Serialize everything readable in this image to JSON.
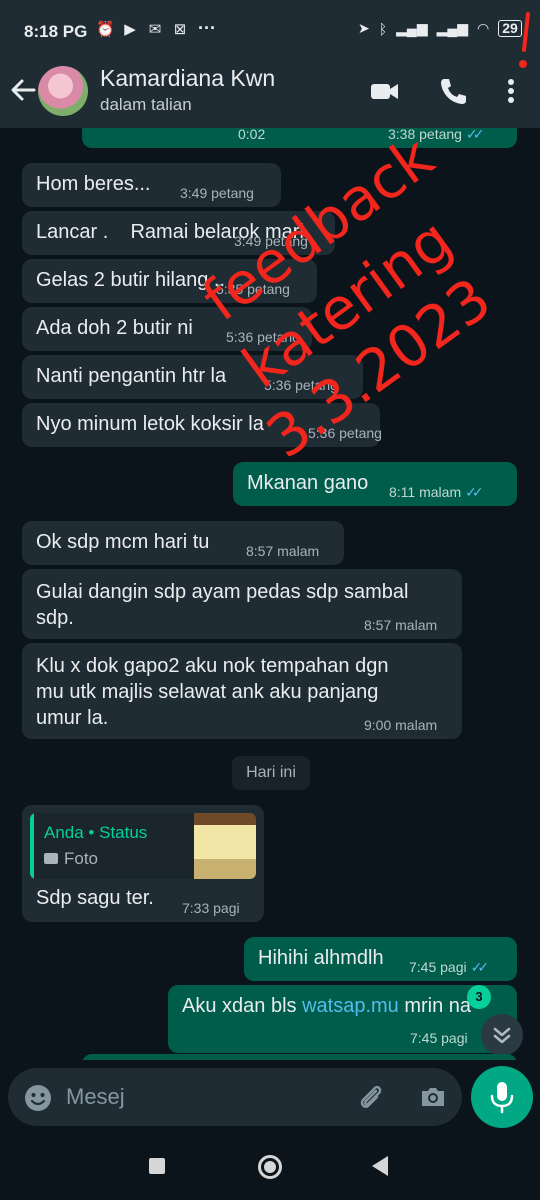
{
  "status_bar": {
    "time": "8:18 PG",
    "notification_icons": [
      "alarm-icon",
      "youtube-icon",
      "mail-icon",
      "app-icon"
    ],
    "more": "···",
    "battery": "29",
    "right_icons": [
      "location-icon",
      "bluetooth-icon",
      "signal-icon",
      "signal-icon",
      "wifi-icon",
      "battery-icon"
    ]
  },
  "header": {
    "contact_name": "Kamardiana Kwn",
    "status": "dalam talian",
    "icons": [
      "back-arrow-icon",
      "avatar",
      "video-call-icon",
      "phone-icon",
      "more-vertical-icon"
    ]
  },
  "chat": {
    "top_partial": {
      "duration": "0:02",
      "time": "3:38 petang"
    },
    "messages": [
      {
        "dir": "in",
        "text": "Hom beres...",
        "time": "3:49 petang"
      },
      {
        "dir": "in",
        "text": "Lancar .    Ramai belarok mari.",
        "time": "3:49 petang"
      },
      {
        "dir": "in",
        "text": "Gelas 2 butir hilang ..",
        "time": "5:35 petang"
      },
      {
        "dir": "in",
        "text": "Ada doh 2 butir ni",
        "time": "5:36 petang"
      },
      {
        "dir": "in",
        "text": "Nanti pengantin htr la",
        "time": "5:36 petang"
      },
      {
        "dir": "in",
        "text": "Nyo minum letok koksir la",
        "time": "5:36 petang"
      },
      {
        "dir": "out",
        "text": "Mkanan gano",
        "time": "8:11 malam"
      },
      {
        "dir": "in",
        "text": "Ok sdp mcm hari tu",
        "time": "8:57 malam"
      },
      {
        "dir": "in",
        "text": "Gulai dangin sdp ayam pedas sdp sambal\nsdp.",
        "time": "8:57 malam"
      },
      {
        "dir": "in",
        "text": "Klu x dok gapo2 aku nok tempahan dgn\nmu utk majlis selawat ank aku panjang\numur la.",
        "time": "9:00 malam"
      },
      {
        "dir": "in",
        "text": "Sdp sagu ter.",
        "time": "7:33 pagi",
        "quote": {
          "author": "Anda • Status",
          "kind": "Foto"
        }
      },
      {
        "dir": "out",
        "text": "Hihihi alhmdlh",
        "time": "7:45 pagi"
      },
      {
        "dir": "out",
        "text_before": "Aku xdan bls ",
        "link": "watsap.mu",
        "text_after": " mrin na",
        "time": "7:45 pagi"
      }
    ],
    "date_divider": "Hari ini",
    "unread_count": "3"
  },
  "overlay": {
    "lines": [
      "feedback",
      "katering",
      "3.3.2023"
    ],
    "color": "#f2261c"
  },
  "composer": {
    "placeholder": "Mesej",
    "icons": [
      "emoji-icon",
      "attach-icon",
      "camera-icon",
      "mic-icon"
    ]
  },
  "navbar": {
    "icons": [
      "recents-icon",
      "home-icon",
      "back-icon"
    ]
  },
  "colors": {
    "incoming": "#202c33",
    "outgoing": "#005c4b",
    "accent": "#00a884",
    "link": "#53bdeb",
    "background": "#0b141a"
  }
}
